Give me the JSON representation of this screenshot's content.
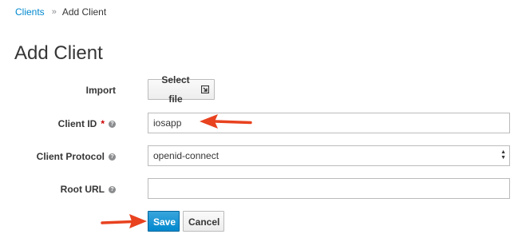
{
  "breadcrumb": {
    "parent": "Clients",
    "separator": "»",
    "current": "Add Client"
  },
  "page": {
    "title": "Add Client"
  },
  "form": {
    "import": {
      "label": "Import",
      "button_label": "Select file",
      "icon": "external-file-icon"
    },
    "client_id": {
      "label": "Client ID",
      "required_marker": "*",
      "value": "iosapp",
      "help_icon": "question-circle-icon"
    },
    "client_protocol": {
      "label": "Client Protocol",
      "selected": "openid-connect",
      "help_icon": "question-circle-icon"
    },
    "root_url": {
      "label": "Root URL",
      "value": "",
      "help_icon": "question-circle-icon"
    }
  },
  "actions": {
    "save_label": "Save",
    "cancel_label": "Cancel"
  },
  "colors": {
    "link": "#0088ce",
    "primary": "#0088ce",
    "annotation_arrow": "#e8421f",
    "required": "#cc0000"
  }
}
